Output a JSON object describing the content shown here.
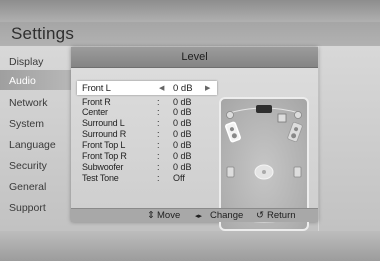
{
  "app": {
    "title": "Settings"
  },
  "menu": {
    "items": [
      {
        "label": "Display",
        "active": false
      },
      {
        "label": "Audio",
        "active": true
      },
      {
        "label": "Network",
        "active": false
      },
      {
        "label": "System",
        "active": false
      },
      {
        "label": "Language",
        "active": false
      },
      {
        "label": "Security",
        "active": false
      },
      {
        "label": "General",
        "active": false
      },
      {
        "label": "Support",
        "active": false
      }
    ]
  },
  "dialog": {
    "title": "Level",
    "rows": [
      {
        "label": "Front L",
        "value": "0 dB",
        "selected": true
      },
      {
        "label": "Front R",
        "value": "0 dB"
      },
      {
        "label": "Center",
        "value": "0 dB"
      },
      {
        "label": "Surround L",
        "value": "0 dB"
      },
      {
        "label": "Surround R",
        "value": "0 dB"
      },
      {
        "label": "Front Top L",
        "value": "0 dB"
      },
      {
        "label": "Front Top R",
        "value": "0 dB"
      },
      {
        "label": "Subwoofer",
        "value": "0 dB"
      },
      {
        "label": "Test Tone",
        "value": "Off"
      }
    ],
    "separator": ":",
    "footer": {
      "move_icon": "⇕",
      "move_label": "Move",
      "change_icon": "◂▸",
      "change_label": "Change",
      "return_icon": "↺",
      "return_label": "Return"
    }
  },
  "colors": {
    "selected_row": "#ffffff",
    "active_menu_text": "#ffffff",
    "dialog_header": "#8e8e8e"
  }
}
